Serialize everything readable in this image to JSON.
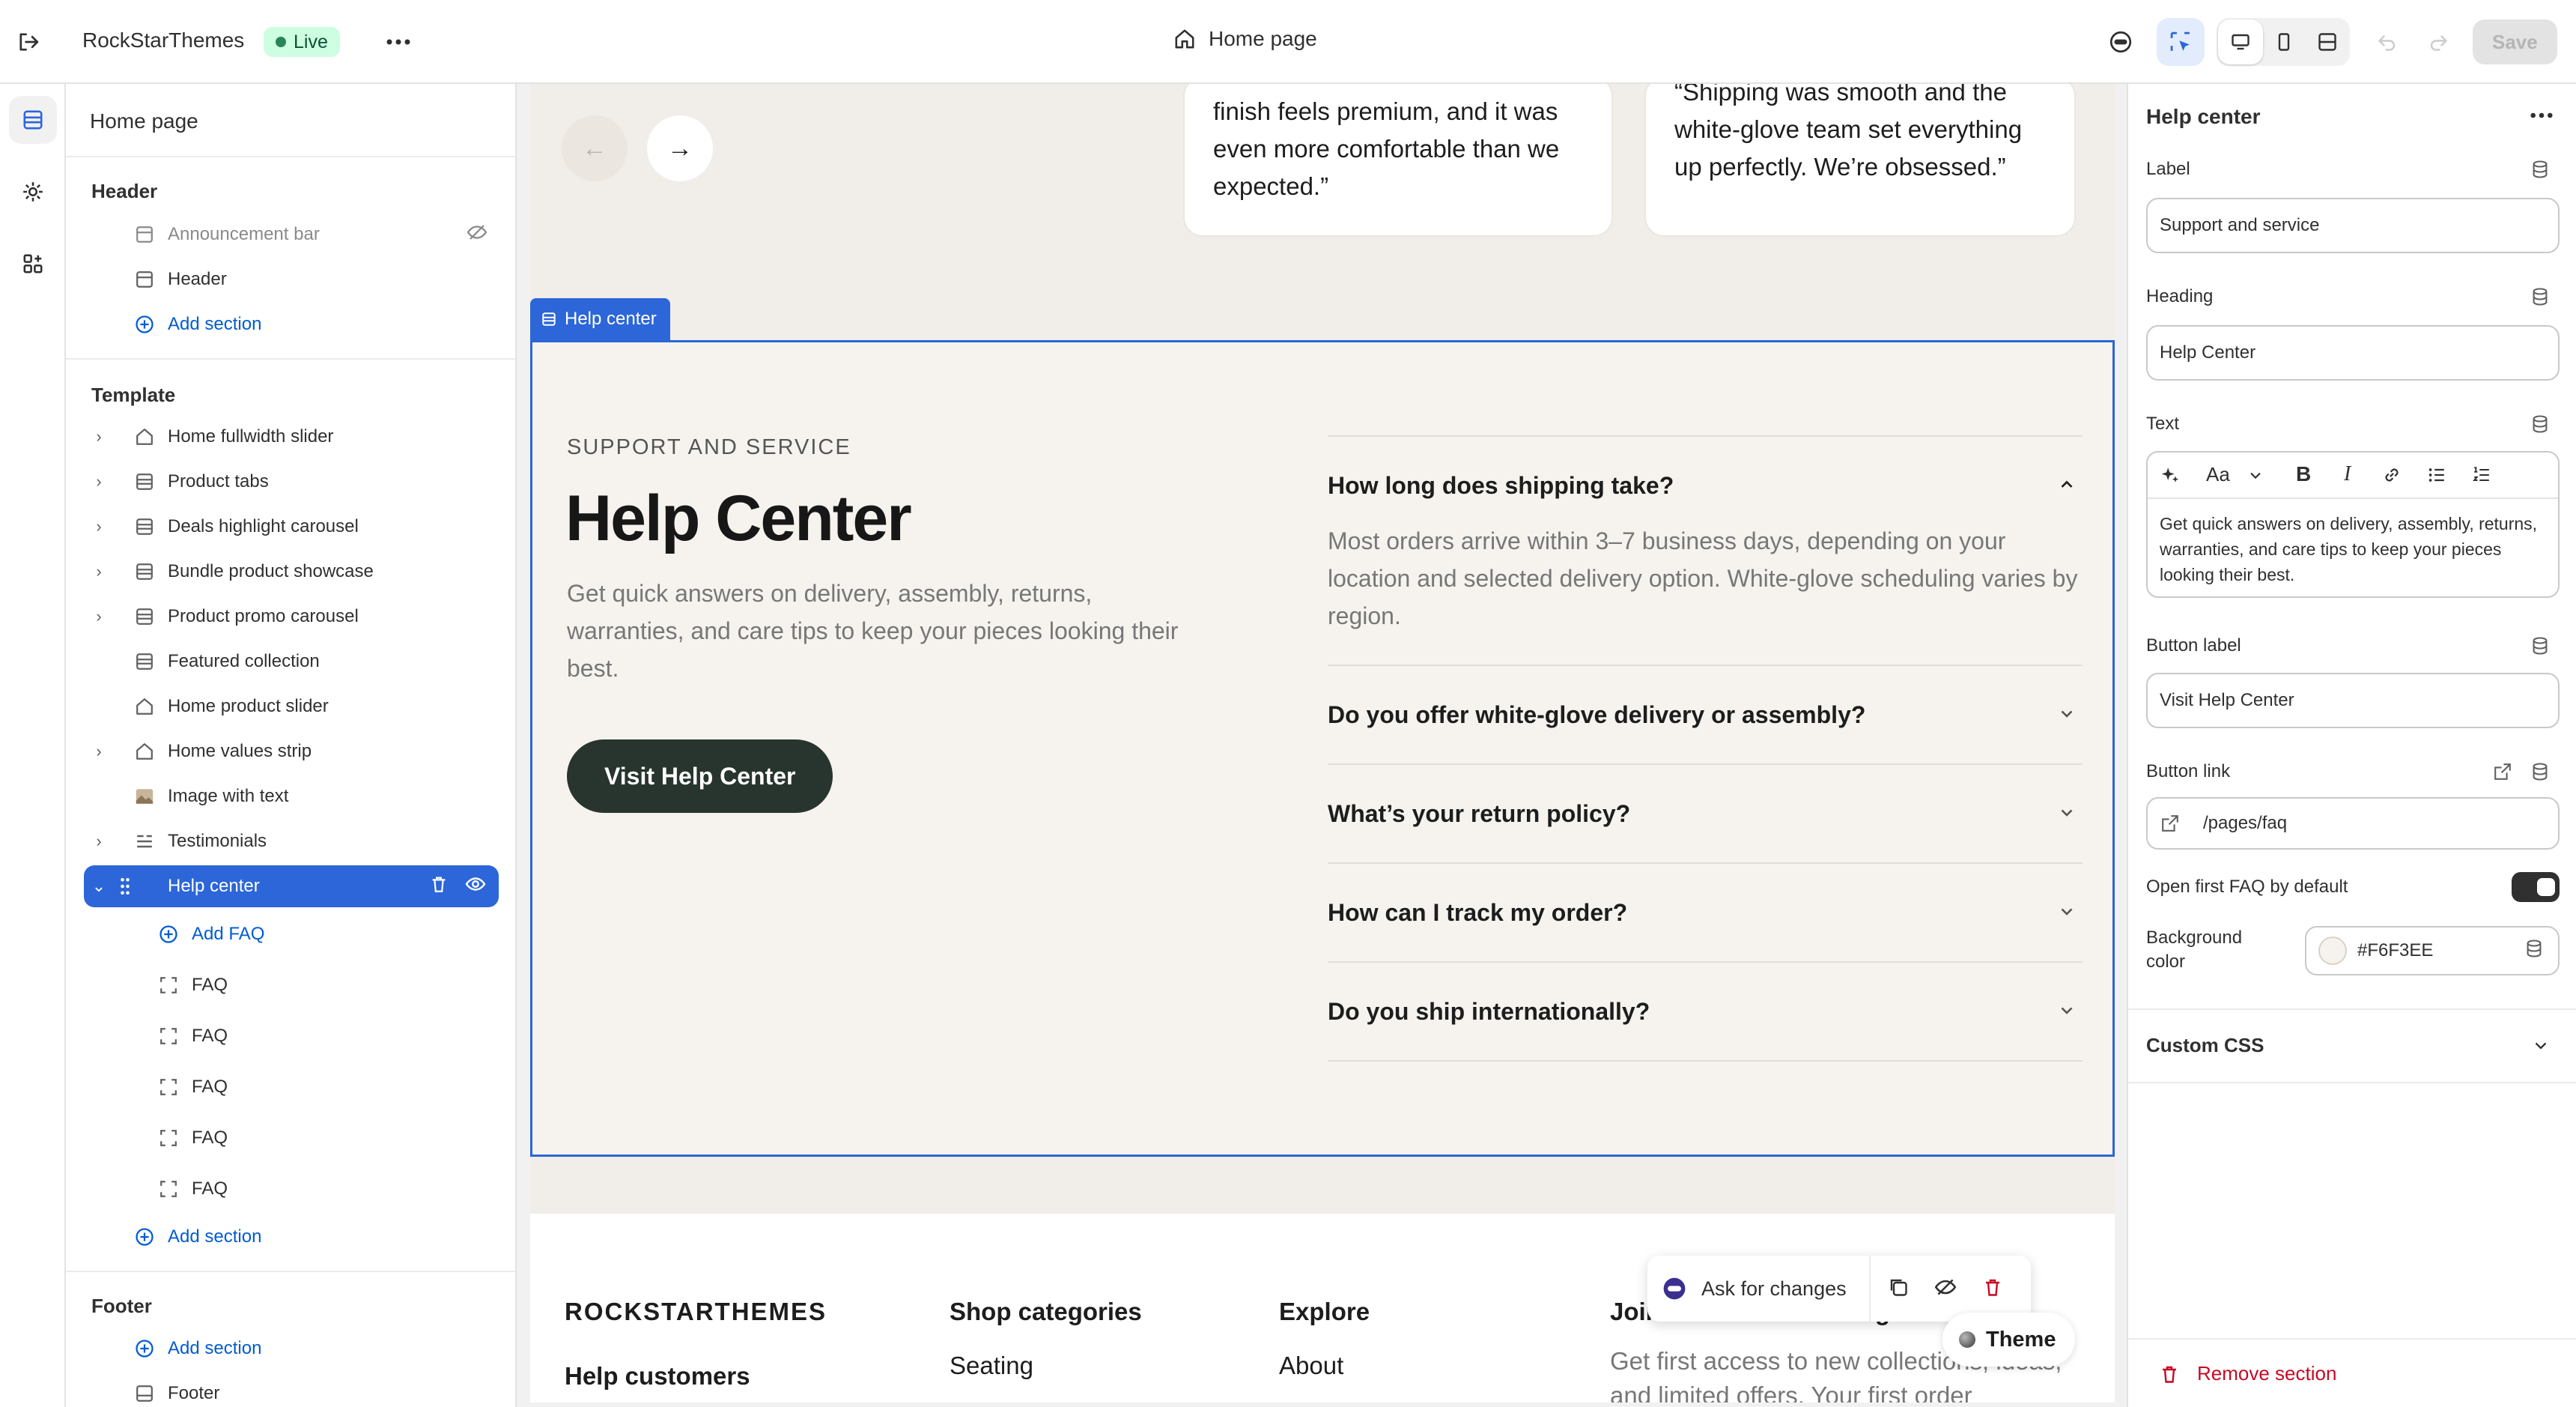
{
  "topbar": {
    "store_name": "RockStarThemes",
    "status": "Live",
    "page_title": "Home page",
    "save_label": "Save"
  },
  "sidebar": {
    "title": "Home page",
    "header_group": "Header",
    "header_items": [
      "Announcement bar",
      "Header"
    ],
    "add_section": "Add section",
    "template_group": "Template",
    "template_items": [
      "Home fullwidth slider",
      "Product tabs",
      "Deals highlight carousel",
      "Bundle product showcase",
      "Product promo carousel",
      "Featured collection",
      "Home product slider",
      "Home values strip",
      "Image with text",
      "Testimonials"
    ],
    "selected_item": "Help center",
    "add_faq": "Add FAQ",
    "faq_label": "FAQ",
    "footer_group": "Footer",
    "footer_items": [
      "Footer"
    ]
  },
  "preview": {
    "testimonials": [
      "finish feels premium, and it was even more comfortable than we expected.”",
      "“Shipping was smooth and the white-glove team set everything up perfectly. We’re obsessed.”"
    ],
    "prev_arrow": "←",
    "next_arrow": "→",
    "section_tag": "Help center",
    "eyebrow": "SUPPORT AND SERVICE",
    "heading": "Help Center",
    "text": "Get quick answers on delivery, assembly, returns, warranties, and care tips to keep your pieces looking their best.",
    "button": "Visit Help Center",
    "faqs": [
      {
        "q": "How long does shipping take?",
        "a": "Most orders arrive within 3–7 business days, depending on your location and selected delivery option. White-glove scheduling varies by region.",
        "open": true
      },
      {
        "q": "Do you offer white-glove delivery or assembly?",
        "a": "",
        "open": false
      },
      {
        "q": "What’s your return policy?",
        "a": "",
        "open": false
      },
      {
        "q": "How can I track my order?",
        "a": "",
        "open": false
      },
      {
        "q": "Do you ship internationally?",
        "a": "",
        "open": false
      }
    ],
    "footer": {
      "brand": "ROCKSTARTHEMES",
      "brand_sub": "Help customers",
      "col2_title": "Shop categories",
      "col2_item": "Seating",
      "col3_title": "Explore",
      "col3_item": "About",
      "col4_title": "Join the Janis list and get 10% off",
      "col4_text": "Get first access to new collections, ideas, and limited offers. Your first order"
    }
  },
  "ask_bar": {
    "label": "Ask for changes"
  },
  "theme_pill": {
    "label": "Theme"
  },
  "settings": {
    "title": "Help center",
    "label_label": "Label",
    "label_value": "Support and service",
    "heading_label": "Heading",
    "heading_value": "Help Center",
    "text_label": "Text",
    "text_value": "Get quick answers on delivery, assembly, returns, warranties, and care tips to keep your pieces looking their best.",
    "button_label_label": "Button label",
    "button_label_value": "Visit Help Center",
    "button_link_label": "Button link",
    "button_link_value": "/pages/faq",
    "open_first_label": "Open first FAQ by default",
    "open_first_value": true,
    "bg_label_1": "Background",
    "bg_label_2": "color",
    "bg_value": "#F6F3EE",
    "custom_css": "Custom CSS",
    "remove_section": "Remove section"
  },
  "colors": {
    "accent": "#2c66d8",
    "live_badge": "#cdfee1",
    "button_dark": "#28352f",
    "danger": "#c70a24"
  }
}
